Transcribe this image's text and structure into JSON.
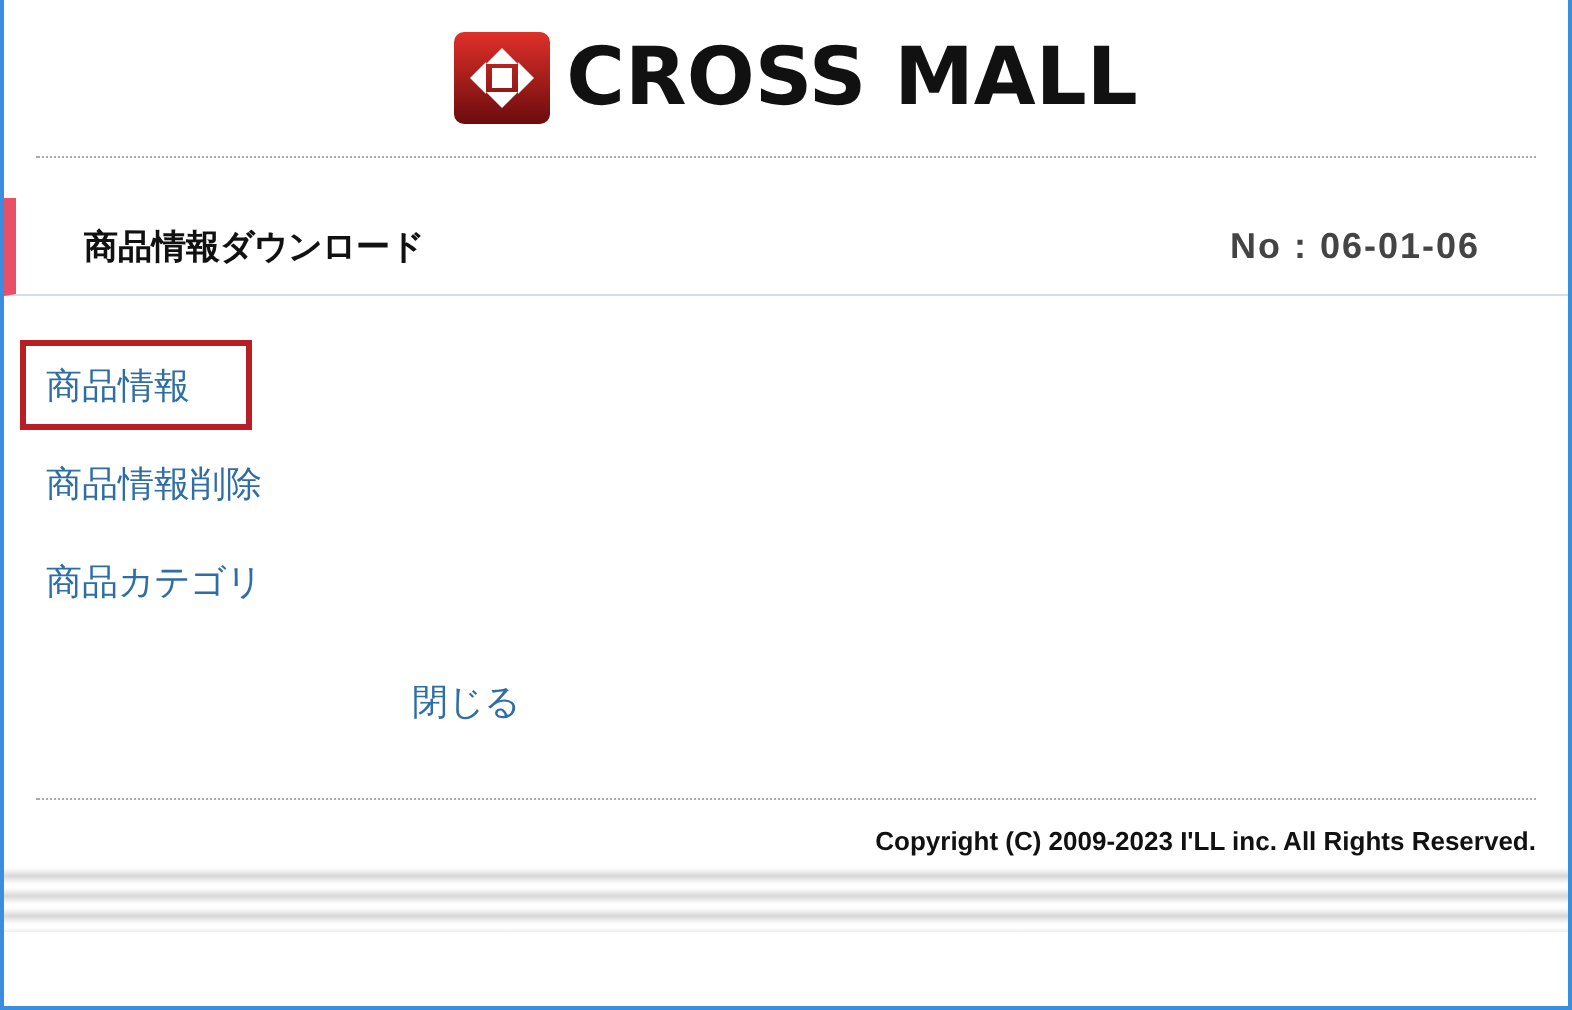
{
  "logo": {
    "text": "CROSS MALL"
  },
  "header": {
    "title": "商品情報ダウンロード",
    "number": "No : 06-01-06"
  },
  "links": [
    {
      "label": "商品情報",
      "highlighted": true
    },
    {
      "label": "商品情報削除",
      "highlighted": false
    },
    {
      "label": "商品カテゴリ",
      "highlighted": false
    }
  ],
  "close_button": {
    "label": "閉じる"
  },
  "footer": {
    "copyright": "Copyright (C) 2009-2023 I'LL inc. All Rights Reserved."
  }
}
